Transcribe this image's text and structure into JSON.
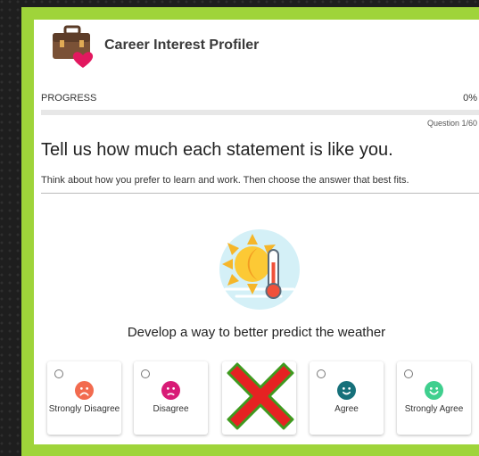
{
  "header": {
    "title": "Career Interest Profiler",
    "logo_icon": "briefcase-heart-icon"
  },
  "progress": {
    "label": "PROGRESS",
    "percent_text": "0%",
    "value": 0,
    "question_text": "Question 1/60"
  },
  "main": {
    "heading": "Tell us how much each statement is like you.",
    "instruction": "Think about how you prefer to learn and work. Then choose the answer that best fits.",
    "illustration_icon": "sun-thermometer-icon",
    "statement": "Develop a way to better predict the weather"
  },
  "options": [
    {
      "label": "Strongly Disagree",
      "icon": "very-sad-face-icon",
      "color": "#f26b4f"
    },
    {
      "label": "Disagree",
      "icon": "sad-face-icon",
      "color": "#d81b76"
    },
    {
      "label": "",
      "icon": "red-x-icon",
      "color": "#e52222"
    },
    {
      "label": "Agree",
      "icon": "happy-face-icon",
      "color": "#16707a"
    },
    {
      "label": "Strongly Agree",
      "icon": "very-happy-face-icon",
      "color": "#3fcf8e"
    }
  ],
  "colors": {
    "frame": "#9fd43a",
    "progress_fill": "#6ab12f",
    "x_mark": "#e52222"
  }
}
